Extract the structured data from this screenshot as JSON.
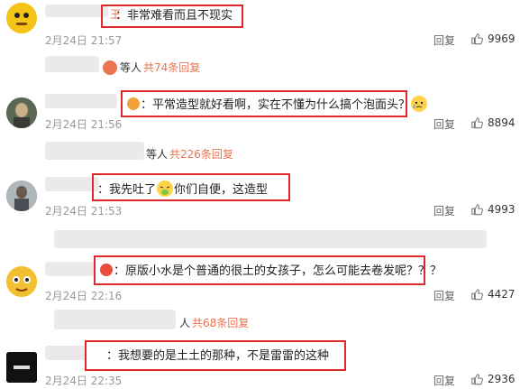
{
  "comments": [
    {
      "text": "：非常难看而且不现实",
      "date": "2月24日 21:57",
      "reply": "回复",
      "likes": "9969"
    },
    {
      "text": "平常造型就好看啊，实在不懂为什么搞个泡面头？",
      "date": "2月24日 21:56",
      "reply": "回复",
      "likes": "8894"
    },
    {
      "text_a": "：我先吐了",
      "text_b": "你们自便，这造型",
      "date": "2月24日 21:53",
      "reply": "回复",
      "likes": "4993"
    },
    {
      "text": "原版小水是个普通的很土的女孩子，怎么可能去卷发呢？？？",
      "date": "2月24日 22:16",
      "reply": "回复",
      "likes": "4427"
    },
    {
      "text": "：我想要的是土土的那种，不是雷雷的这种",
      "date": "2月24日 22:35",
      "reply": "回复",
      "likes": "2936"
    }
  ],
  "threads": [
    {
      "who": "等人",
      "count": "共74条回复"
    },
    {
      "who": "等人",
      "count": "共226条回复"
    },
    {
      "who": "人",
      "count": "共68条回复"
    }
  ],
  "partial": {
    "name_tail": "王"
  },
  "icons": {
    "like": "thumbs-up-icon",
    "emoji_cry": "crying-face-icon",
    "emoji_vomit": "vomit-face-icon"
  },
  "colors": {
    "highlight_box": "#e0282a",
    "reply_count": "#eb7350"
  }
}
